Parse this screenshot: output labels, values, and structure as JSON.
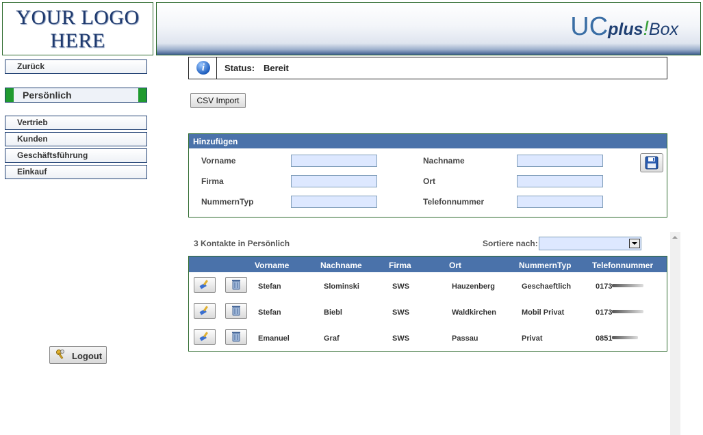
{
  "header": {
    "logo_line1": "YOUR LOGO",
    "logo_line2": "HERE",
    "brand_uc": "UC",
    "brand_plus": "plus",
    "brand_excl": "!",
    "brand_box": "Box"
  },
  "nav": {
    "back": "Zurück",
    "active": "Persönlich",
    "items": [
      "Vertrieb",
      "Kunden",
      "Geschäftsführung",
      "Einkauf"
    ],
    "logout": "Logout"
  },
  "status": {
    "label": "Status:",
    "value": "Bereit",
    "icon": "info-icon"
  },
  "csv_button": "CSV Import",
  "add_form": {
    "title": "Hinzufügen",
    "fields": {
      "vorname": "Vorname",
      "nachname": "Nachname",
      "firma": "Firma",
      "ort": "Ort",
      "nummerntyp": "NummernTyp",
      "telefonnummer": "Telefonnummer"
    },
    "values": {
      "vorname": "",
      "nachname": "",
      "firma": "",
      "ort": "",
      "nummerntyp": "",
      "telefonnummer": ""
    },
    "save_icon": "floppy-disk-icon"
  },
  "list": {
    "count_text": "3 Kontakte in Persönlich",
    "sort_label": "Sortiere nach:",
    "sort_value": "",
    "columns": [
      "Vorname",
      "Nachname",
      "Firma",
      "Ort",
      "NummernTyp",
      "Telefonnummer"
    ],
    "rows": [
      {
        "vorname": "Stefan",
        "nachname": "Slominski",
        "firma": "SWS",
        "ort": "Hauzenberg",
        "typ": "Geschaeftlich",
        "tel": "0173"
      },
      {
        "vorname": "Stefan",
        "nachname": "Biebl",
        "firma": "SWS",
        "ort": "Waldkirchen",
        "typ": "Mobil Privat",
        "tel": "0173"
      },
      {
        "vorname": "Emanuel",
        "nachname": "Graf",
        "firma": "SWS",
        "ort": "Passau",
        "typ": "Privat",
        "tel": "0851"
      }
    ]
  },
  "colors": {
    "header_blue": "#4a72aa",
    "border_green": "#2d6a2d",
    "active_green": "#1f9a2f",
    "input_bg": "#dde8ff"
  }
}
